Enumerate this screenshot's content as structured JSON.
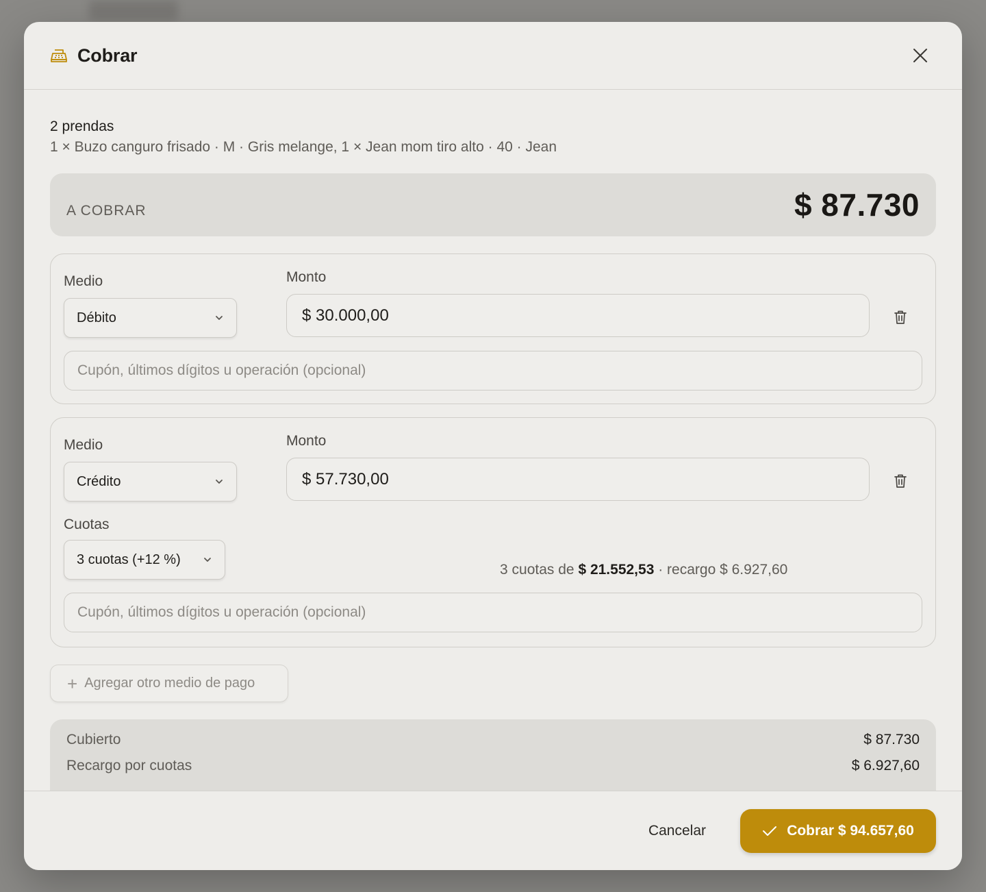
{
  "modal": {
    "title": "Cobrar",
    "icon": "cash-register-icon",
    "close_icon": "close-icon"
  },
  "items": {
    "count_label": "2 prendas",
    "description": "1 × Buzo canguro frisado · M · Gris melange, 1 × Jean mom tiro alto · 40 · Jean"
  },
  "total": {
    "label": "A COBRAR",
    "amount": "$ 87.730"
  },
  "payments": [
    {
      "method_label": "Medio",
      "method_value": "Débito",
      "amount_label": "Monto",
      "amount_value": "$ 30.000,00",
      "note_placeholder": "Cupón, últimos dígitos u operación (opcional)"
    },
    {
      "method_label": "Medio",
      "method_value": "Crédito",
      "amount_label": "Monto",
      "amount_value": "$ 57.730,00",
      "installments_label": "Cuotas",
      "installments_value": "3 cuotas (+12 %)",
      "installments_info_prefix": "3 cuotas de",
      "installments_info_amount": "$ 21.552,53",
      "installments_info_suffix": "· recargo $ 6.927,60",
      "note_placeholder": "Cupón, últimos dígitos u operación (opcional)"
    }
  ],
  "add_payment_label": "Agregar otro medio de pago",
  "summary": {
    "covered_label": "Cubierto",
    "covered_value": "$ 87.730",
    "surcharge_label": "Recargo por cuotas",
    "surcharge_value": "$ 6.927,60"
  },
  "footer": {
    "cancel_label": "Cancelar",
    "confirm_label": "Cobrar $ 94.657,60"
  },
  "colors": {
    "accent": "#be8c0b",
    "modal_bg": "#eeedea",
    "panel_bg": "#dddcd8"
  }
}
